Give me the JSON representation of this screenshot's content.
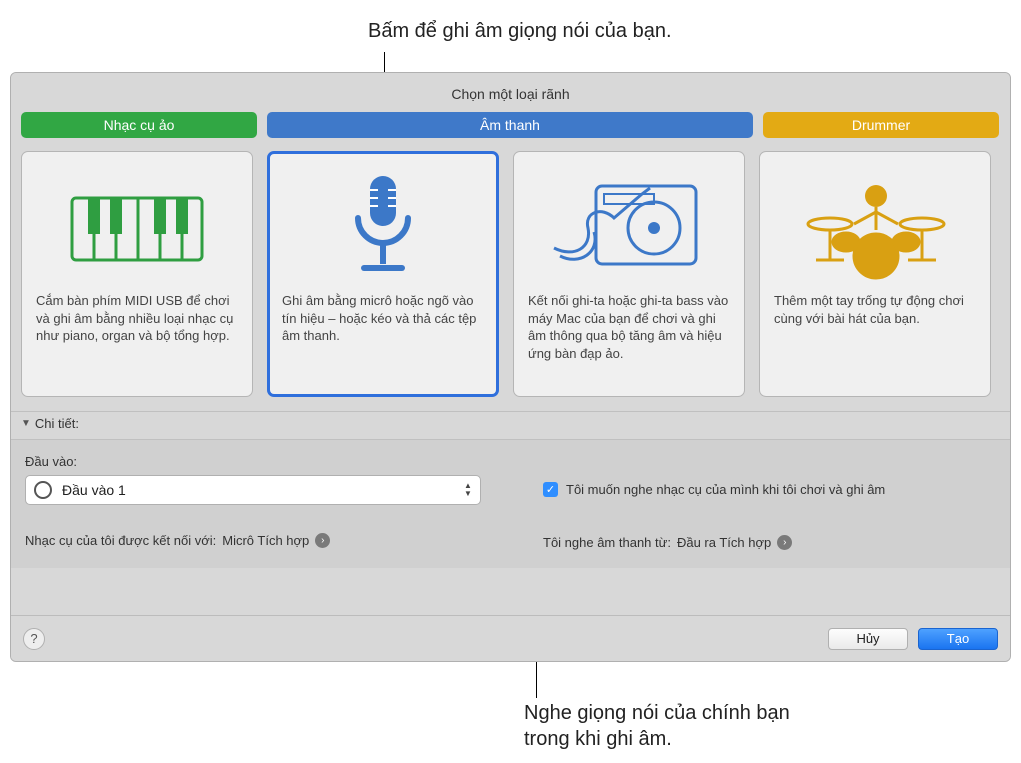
{
  "callouts": {
    "top": "Bấm để ghi âm giọng nói của bạn.",
    "bottom_l1": "Nghe giọng nói của chính bạn",
    "bottom_l2": "trong khi ghi âm."
  },
  "panel": {
    "title": "Chọn một loại rãnh"
  },
  "tabs": {
    "virtual": "Nhạc cụ ảo",
    "audio": "Âm thanh",
    "drummer": "Drummer"
  },
  "cards": {
    "virtual_desc": "Cắm bàn phím MIDI USB để chơi và ghi âm bằng nhiều loại nhạc cụ như piano, organ và bộ tổng hợp.",
    "audio_mic_desc": "Ghi âm bằng micrô hoặc ngõ vào tín hiệu – hoặc kéo và thả các tệp âm thanh.",
    "audio_guitar_desc": "Kết nối ghi-ta hoặc ghi-ta bass vào máy Mac của bạn để chơi và ghi âm thông qua bộ tăng âm và hiệu ứng bàn đạp ảo.",
    "drummer_desc": "Thêm một tay trống tự động chơi cùng với bài hát của bạn."
  },
  "details": {
    "label": "Chi tiết:",
    "input_label": "Đầu vào:",
    "input_select_value": "Đầu vào 1",
    "connected_label": "Nhạc cụ của tôi được kết nối với:",
    "connected_value": "Micrô Tích hợp",
    "monitor_check": "Tôi muốn nghe nhạc cụ của mình khi tôi chơi và ghi âm",
    "hear_label": "Tôi nghe âm thanh từ:",
    "hear_value": "Đầu ra Tích hợp"
  },
  "footer": {
    "help": "?",
    "cancel": "Hủy",
    "create": "Tạo"
  },
  "colors": {
    "green": "#31a744",
    "blue": "#3f79c9",
    "yellow": "#e3aa14",
    "accent": "#2f6fdc"
  }
}
